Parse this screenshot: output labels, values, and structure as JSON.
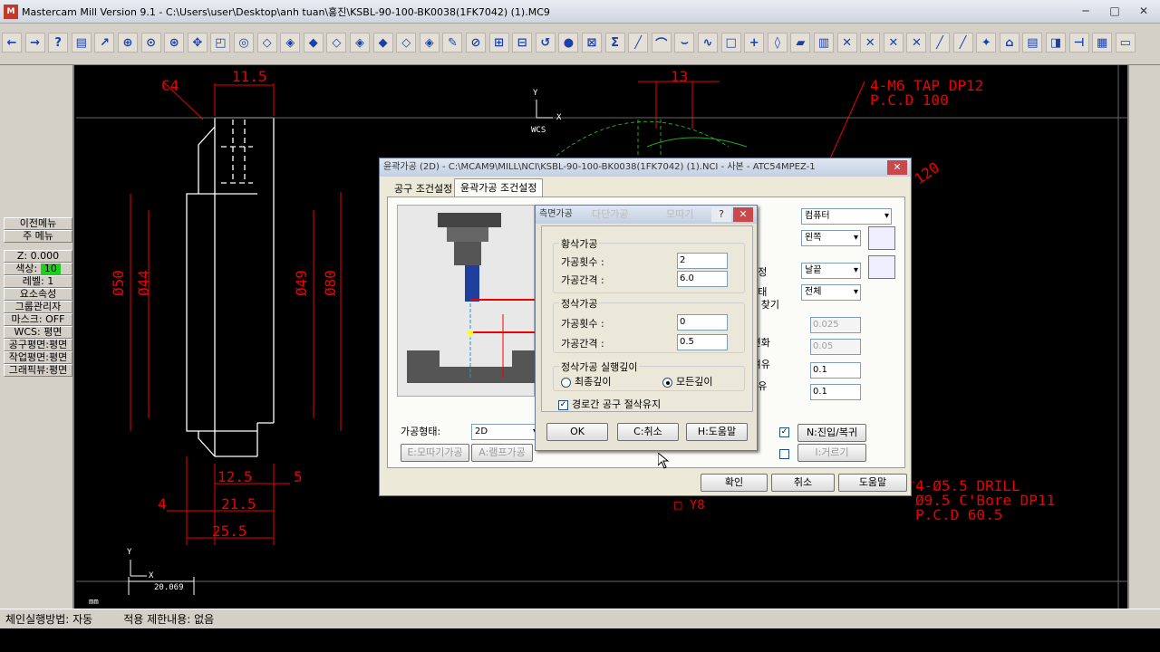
{
  "app": {
    "title": "Mastercam Mill Version 9.1 - C:\\Users\\user\\Desktop\\anh tuan\\홍진\\KSBL-90-100-BK0038(1FK7042) (1).MC9",
    "logo_text": "M"
  },
  "window_buttons": [
    "─",
    "□",
    "✕"
  ],
  "toolbar": [
    "←",
    "→",
    "?",
    "▤",
    "↗",
    "⊕",
    "⊙",
    "⊛",
    "✥",
    "◰",
    "◎",
    "◇",
    "◈",
    "◆",
    "◇",
    "◈",
    "◆",
    "◇",
    "◈",
    "✎",
    "⊘",
    "⊞",
    "⊟",
    "↺",
    "●",
    "⊠",
    "Σ",
    "╱",
    "⌒",
    "⌣",
    "∿",
    "□",
    "+",
    "◊",
    "▰",
    "▥",
    "✕",
    "✕",
    "✕",
    "✕",
    "╱",
    "╱",
    "✦",
    "⌂",
    "▤",
    "◨",
    "⊣",
    "▦",
    "▭"
  ],
  "left_panel": {
    "prev_menu": "이전메뉴",
    "main_menu": "주 메뉴",
    "z_label": "Z:",
    "z_value": "0.000",
    "color_label": "색상:",
    "color_value": "10",
    "level_label": "레벨:",
    "level_value": "1",
    "attributes": "요소속성",
    "group_manager": "그룹관리자",
    "mask_label": "마스크:",
    "mask_value": "OFF",
    "wcs_label": "WCS:",
    "wcs_value": "평면",
    "tool_plane": "공구평면:평면",
    "construction_plane": "작업평면:평면",
    "graphic_view": "그래픽뷰:평면"
  },
  "drawing": {
    "dims": [
      "C4",
      "11.5",
      "13",
      "4-M6 TAP DP12",
      "P.C.D 100",
      "120",
      "Ø50",
      "Ø44",
      "Ø49",
      "Ø80",
      "12.5",
      "5",
      "4",
      "21.5",
      "25.5",
      "4-Ø5.5 DRILL",
      "Ø9.5 C'Bore DP11",
      "P.C.D 60.5",
      "□ Y8"
    ],
    "wcs_label": "WCS",
    "axis_y": "Y",
    "axis_x": "X",
    "scale_value": "20.069",
    "units": "mm"
  },
  "status_bar": {
    "chain_method": "체인실행방법: 자동",
    "limit": "적용 제한내용: 없음"
  },
  "main_dialog": {
    "title": "윤곽가공 (2D) - C:\\MCAM9\\MILL\\NCI\\KSBL-90-100-BK0038(1FK7042) (1).NCI - 사본 - ATC54MPEZ-1",
    "tabs": [
      "공구 조건설정",
      "윤곽가공 조건설정"
    ],
    "right_labels": [
      "보정",
      "보정",
      "이보정",
      "송형태",
      "으로 찾기",
      "차",
      "이 변화",
      "공 여유",
      "공여유"
    ],
    "comp_type": "컴퓨터",
    "comp_dir": "왼쪽",
    "tip_comp": "날끝",
    "roll_corner": "전체",
    "tolerance": "0.025",
    "max_depth_var": "0.05",
    "xy_stock": "0.1",
    "z_stock": "0.1",
    "machining_type_label": "가공형태:",
    "machining_type": "2D",
    "lead_inout_btn": "N:진입/복귀",
    "filter_btn": "I:거르기",
    "depth_cut_btn": "E:모따기가공",
    "ramp_btn": "A:램프가공",
    "ok": "확인",
    "cancel": "취소",
    "help": "도움말"
  },
  "sub_dialog": {
    "title": "측면가공",
    "tab_ghost_1": "다단가공",
    "tab_ghost_2": "모따기",
    "rough_group": "황삭가공",
    "rough_count_label": "가공횟수 :",
    "rough_count": "2",
    "rough_step_label": "가공간격 :",
    "rough_step": "6.0",
    "finish_group": "정삭가공",
    "finish_count_label": "가공횟수 :",
    "finish_count": "0",
    "finish_step_label": "가공간격 :",
    "finish_step": "0.5",
    "finish_depth_group": "정삭가공 실행깊이",
    "opt_final": "최종깊이",
    "opt_all": "모든깊이",
    "keep_tool_down": "경로간 공구 절삭유지",
    "ok": "OK",
    "cancel": "C:취소",
    "help": "H:도움말"
  }
}
